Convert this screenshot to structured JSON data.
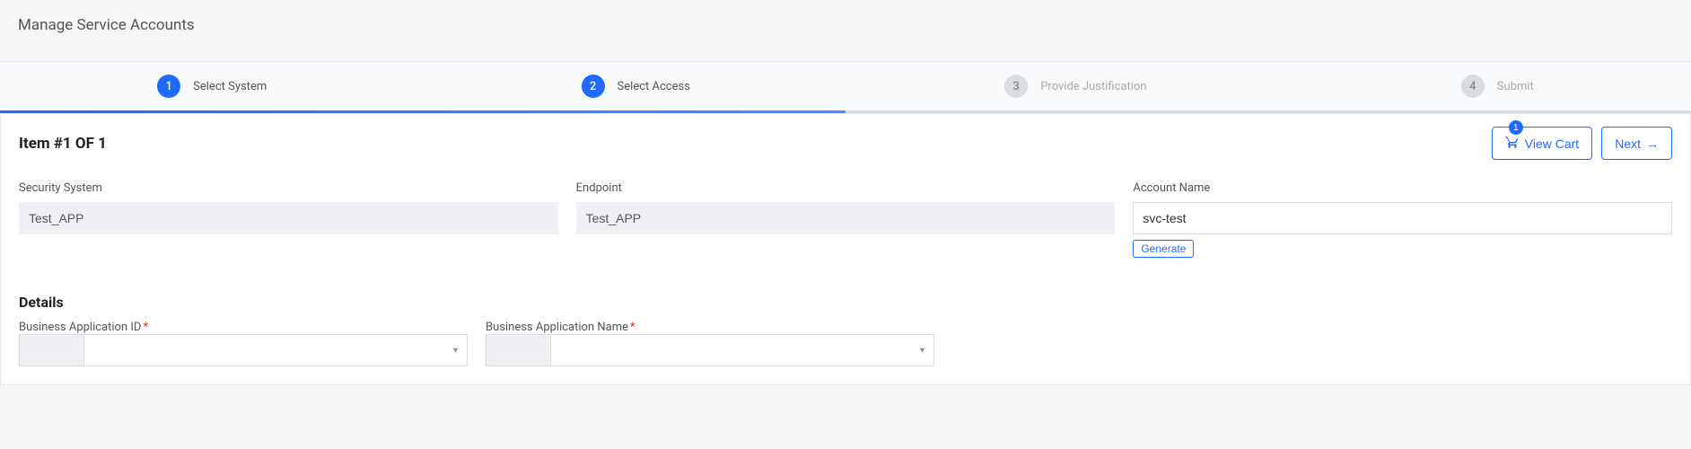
{
  "header": {
    "title": "Manage Service Accounts"
  },
  "stepper": {
    "steps": [
      {
        "num": "1",
        "label": "Select System",
        "active": true
      },
      {
        "num": "2",
        "label": "Select Access",
        "active": true
      },
      {
        "num": "3",
        "label": "Provide Justification",
        "active": false
      },
      {
        "num": "4",
        "label": "Submit",
        "active": false
      }
    ],
    "progress_percent": 50
  },
  "card": {
    "item_count_label": "Item #1 OF 1",
    "view_cart_label": "View Cart",
    "cart_badge": "1",
    "next_label": "Next"
  },
  "form": {
    "security_system": {
      "label": "Security System",
      "value": "Test_APP"
    },
    "endpoint": {
      "label": "Endpoint",
      "value": "Test_APP"
    },
    "account_name": {
      "label": "Account Name",
      "value": "svc-test",
      "generate_label": "Generate"
    }
  },
  "details": {
    "section_title": "Details",
    "business_app_id": {
      "label": "Business Application ID",
      "required": true,
      "value": ""
    },
    "business_app_name": {
      "label": "Business Application Name",
      "required": true,
      "value": ""
    }
  }
}
